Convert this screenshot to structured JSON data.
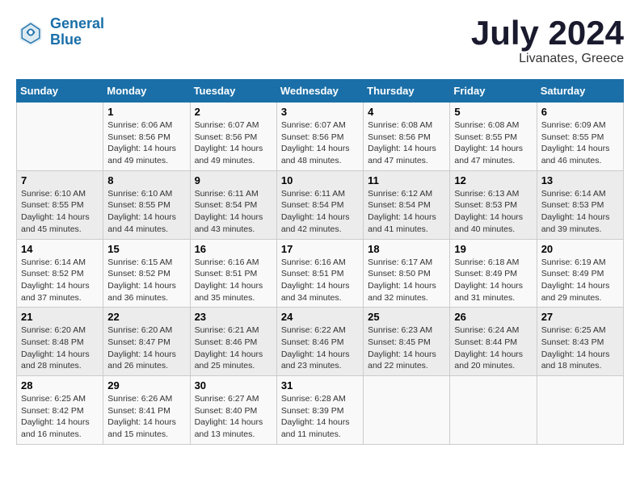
{
  "header": {
    "logo_line1": "General",
    "logo_line2": "Blue",
    "month": "July 2024",
    "location": "Livanates, Greece"
  },
  "weekdays": [
    "Sunday",
    "Monday",
    "Tuesday",
    "Wednesday",
    "Thursday",
    "Friday",
    "Saturday"
  ],
  "weeks": [
    [
      {
        "day": "",
        "info": ""
      },
      {
        "day": "1",
        "info": "Sunrise: 6:06 AM\nSunset: 8:56 PM\nDaylight: 14 hours\nand 49 minutes."
      },
      {
        "day": "2",
        "info": "Sunrise: 6:07 AM\nSunset: 8:56 PM\nDaylight: 14 hours\nand 49 minutes."
      },
      {
        "day": "3",
        "info": "Sunrise: 6:07 AM\nSunset: 8:56 PM\nDaylight: 14 hours\nand 48 minutes."
      },
      {
        "day": "4",
        "info": "Sunrise: 6:08 AM\nSunset: 8:56 PM\nDaylight: 14 hours\nand 47 minutes."
      },
      {
        "day": "5",
        "info": "Sunrise: 6:08 AM\nSunset: 8:55 PM\nDaylight: 14 hours\nand 47 minutes."
      },
      {
        "day": "6",
        "info": "Sunrise: 6:09 AM\nSunset: 8:55 PM\nDaylight: 14 hours\nand 46 minutes."
      }
    ],
    [
      {
        "day": "7",
        "info": "Sunrise: 6:10 AM\nSunset: 8:55 PM\nDaylight: 14 hours\nand 45 minutes."
      },
      {
        "day": "8",
        "info": "Sunrise: 6:10 AM\nSunset: 8:55 PM\nDaylight: 14 hours\nand 44 minutes."
      },
      {
        "day": "9",
        "info": "Sunrise: 6:11 AM\nSunset: 8:54 PM\nDaylight: 14 hours\nand 43 minutes."
      },
      {
        "day": "10",
        "info": "Sunrise: 6:11 AM\nSunset: 8:54 PM\nDaylight: 14 hours\nand 42 minutes."
      },
      {
        "day": "11",
        "info": "Sunrise: 6:12 AM\nSunset: 8:54 PM\nDaylight: 14 hours\nand 41 minutes."
      },
      {
        "day": "12",
        "info": "Sunrise: 6:13 AM\nSunset: 8:53 PM\nDaylight: 14 hours\nand 40 minutes."
      },
      {
        "day": "13",
        "info": "Sunrise: 6:14 AM\nSunset: 8:53 PM\nDaylight: 14 hours\nand 39 minutes."
      }
    ],
    [
      {
        "day": "14",
        "info": "Sunrise: 6:14 AM\nSunset: 8:52 PM\nDaylight: 14 hours\nand 37 minutes."
      },
      {
        "day": "15",
        "info": "Sunrise: 6:15 AM\nSunset: 8:52 PM\nDaylight: 14 hours\nand 36 minutes."
      },
      {
        "day": "16",
        "info": "Sunrise: 6:16 AM\nSunset: 8:51 PM\nDaylight: 14 hours\nand 35 minutes."
      },
      {
        "day": "17",
        "info": "Sunrise: 6:16 AM\nSunset: 8:51 PM\nDaylight: 14 hours\nand 34 minutes."
      },
      {
        "day": "18",
        "info": "Sunrise: 6:17 AM\nSunset: 8:50 PM\nDaylight: 14 hours\nand 32 minutes."
      },
      {
        "day": "19",
        "info": "Sunrise: 6:18 AM\nSunset: 8:49 PM\nDaylight: 14 hours\nand 31 minutes."
      },
      {
        "day": "20",
        "info": "Sunrise: 6:19 AM\nSunset: 8:49 PM\nDaylight: 14 hours\nand 29 minutes."
      }
    ],
    [
      {
        "day": "21",
        "info": "Sunrise: 6:20 AM\nSunset: 8:48 PM\nDaylight: 14 hours\nand 28 minutes."
      },
      {
        "day": "22",
        "info": "Sunrise: 6:20 AM\nSunset: 8:47 PM\nDaylight: 14 hours\nand 26 minutes."
      },
      {
        "day": "23",
        "info": "Sunrise: 6:21 AM\nSunset: 8:46 PM\nDaylight: 14 hours\nand 25 minutes."
      },
      {
        "day": "24",
        "info": "Sunrise: 6:22 AM\nSunset: 8:46 PM\nDaylight: 14 hours\nand 23 minutes."
      },
      {
        "day": "25",
        "info": "Sunrise: 6:23 AM\nSunset: 8:45 PM\nDaylight: 14 hours\nand 22 minutes."
      },
      {
        "day": "26",
        "info": "Sunrise: 6:24 AM\nSunset: 8:44 PM\nDaylight: 14 hours\nand 20 minutes."
      },
      {
        "day": "27",
        "info": "Sunrise: 6:25 AM\nSunset: 8:43 PM\nDaylight: 14 hours\nand 18 minutes."
      }
    ],
    [
      {
        "day": "28",
        "info": "Sunrise: 6:25 AM\nSunset: 8:42 PM\nDaylight: 14 hours\nand 16 minutes."
      },
      {
        "day": "29",
        "info": "Sunrise: 6:26 AM\nSunset: 8:41 PM\nDaylight: 14 hours\nand 15 minutes."
      },
      {
        "day": "30",
        "info": "Sunrise: 6:27 AM\nSunset: 8:40 PM\nDaylight: 14 hours\nand 13 minutes."
      },
      {
        "day": "31",
        "info": "Sunrise: 6:28 AM\nSunset: 8:39 PM\nDaylight: 14 hours\nand 11 minutes."
      },
      {
        "day": "",
        "info": ""
      },
      {
        "day": "",
        "info": ""
      },
      {
        "day": "",
        "info": ""
      }
    ]
  ]
}
